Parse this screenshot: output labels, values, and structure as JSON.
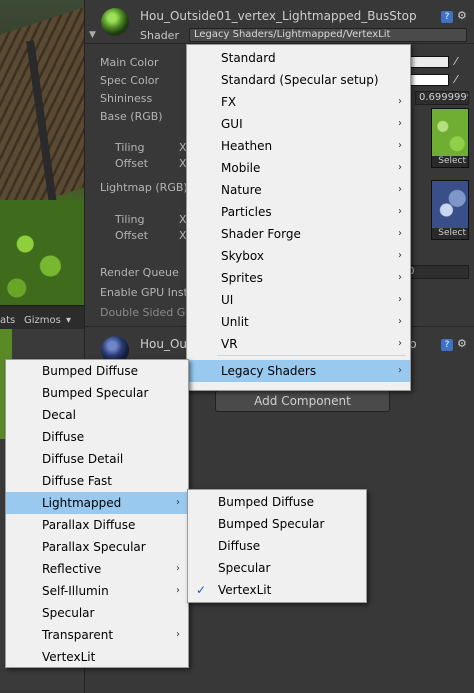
{
  "scene_toolbar": {
    "left_label": "ats",
    "gizmos_label": "Gizmos"
  },
  "inspector": {
    "material1": {
      "title": "Hou_Outside01_vertex_Lightmapped_BusStop",
      "shader_label": "Shader",
      "shader_value": "Legacy Shaders/Lightmapped/VertexLit",
      "props": {
        "main_color": "Main Color",
        "spec_color": "Spec Color",
        "shininess": "Shininess",
        "shininess_value": "0.6999999",
        "base_rgb": "Base (RGB)",
        "tiling": "Tiling",
        "offset": "Offset",
        "x": "X",
        "lightmap": "Lightmap (RGB)",
        "render_queue": "Render Queue",
        "render_queue_value": "2000",
        "gpu_instancing": "Enable GPU Instancing",
        "double_sided": "Double Sided Global Illumination",
        "select": "Select"
      }
    },
    "material2": {
      "title": "Hou_Outside01_vertex_Lightmapped_BusStop"
    },
    "add_component": "Add Component"
  },
  "menu1": {
    "items": [
      {
        "label": "Standard",
        "sub": false
      },
      {
        "label": "Standard (Specular setup)",
        "sub": false
      },
      {
        "label": "FX",
        "sub": true
      },
      {
        "label": "GUI",
        "sub": true
      },
      {
        "label": "Heathen",
        "sub": true
      },
      {
        "label": "Mobile",
        "sub": true
      },
      {
        "label": "Nature",
        "sub": true
      },
      {
        "label": "Particles",
        "sub": true
      },
      {
        "label": "Shader Forge",
        "sub": true
      },
      {
        "label": "Skybox",
        "sub": true
      },
      {
        "label": "Sprites",
        "sub": true
      },
      {
        "label": "UI",
        "sub": true
      },
      {
        "label": "Unlit",
        "sub": true
      },
      {
        "label": "VR",
        "sub": true
      },
      {
        "label": "Legacy Shaders",
        "sub": true
      }
    ],
    "arrow": "›"
  },
  "menu2": {
    "items": [
      {
        "label": "Bumped Diffuse"
      },
      {
        "label": "Bumped Specular"
      },
      {
        "label": "Decal"
      },
      {
        "label": "Diffuse"
      },
      {
        "label": "Diffuse Detail"
      },
      {
        "label": "Diffuse Fast"
      },
      {
        "label": "Lightmapped"
      },
      {
        "label": "Parallax Diffuse"
      },
      {
        "label": "Parallax Specular"
      },
      {
        "label": "Reflective"
      },
      {
        "label": "Self-Illumin"
      },
      {
        "label": "Specular"
      },
      {
        "label": "Transparent"
      },
      {
        "label": "VertexLit"
      }
    ]
  },
  "menu3": {
    "items": [
      {
        "label": "Bumped Diffuse"
      },
      {
        "label": "Bumped Specular"
      },
      {
        "label": "Diffuse"
      },
      {
        "label": "Specular"
      },
      {
        "label": "VertexLit"
      }
    ],
    "check": "✓"
  },
  "colors": {
    "highlight": "#99c9ef",
    "menu_bg": "#f0f0f0",
    "panel_bg": "#383838"
  }
}
